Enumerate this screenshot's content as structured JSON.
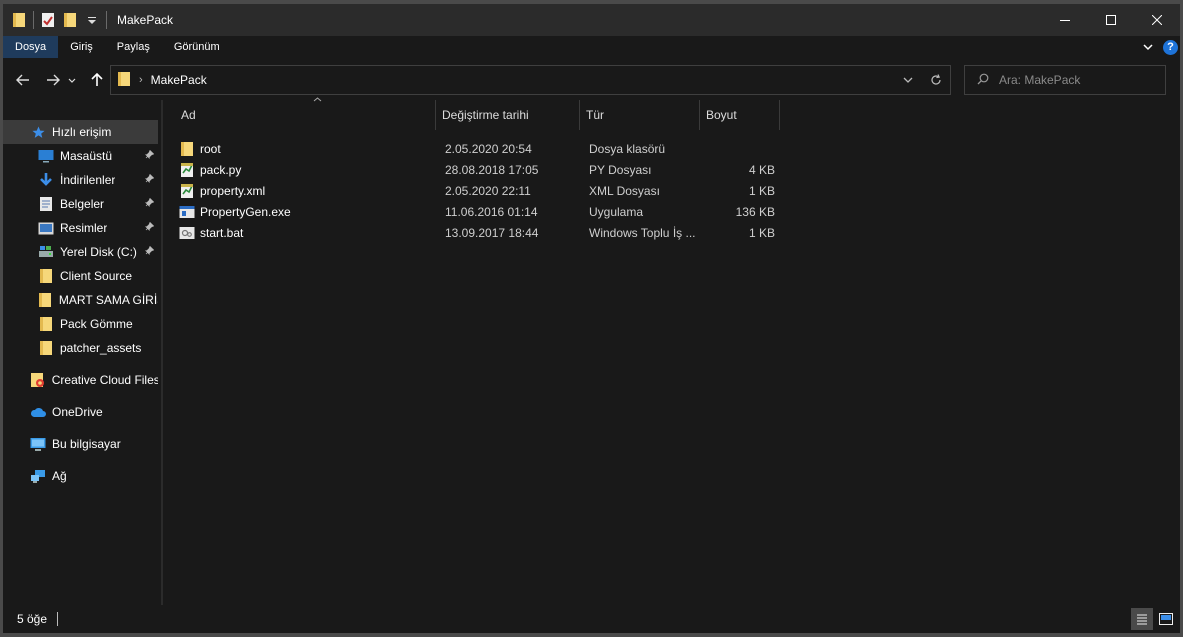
{
  "window": {
    "title": "MakePack"
  },
  "ribbon": {
    "tabs": [
      {
        "label": "Dosya",
        "active": true
      },
      {
        "label": "Giriş",
        "active": false
      },
      {
        "label": "Paylaş",
        "active": false
      },
      {
        "label": "Görünüm",
        "active": false
      }
    ],
    "help_label": "?"
  },
  "address": {
    "crumb": "MakePack"
  },
  "search": {
    "placeholder": "Ara: MakePack"
  },
  "nav": {
    "items": [
      {
        "label": "Hızlı erişim",
        "icon": "star-icon"
      },
      {
        "label": "Masaüstü",
        "icon": "desktop-icon",
        "pinned": true
      },
      {
        "label": "İndirilenler",
        "icon": "download-icon",
        "pinned": true
      },
      {
        "label": "Belgeler",
        "icon": "documents-icon",
        "pinned": true
      },
      {
        "label": "Resimler",
        "icon": "pictures-icon",
        "pinned": true
      },
      {
        "label": "Yerel Disk (C:)",
        "icon": "disk-icon",
        "pinned": true
      },
      {
        "label": "Client Source",
        "icon": "folder-icon"
      },
      {
        "label": "MART SAMA GİRİŞ",
        "icon": "folder-icon"
      },
      {
        "label": "Pack Gömme",
        "icon": "folder-icon"
      },
      {
        "label": "patcher_assets",
        "icon": "folder-icon"
      },
      {
        "label": "Creative Cloud Files",
        "icon": "creative-cloud-icon"
      },
      {
        "label": "OneDrive",
        "icon": "onedrive-icon"
      },
      {
        "label": "Bu bilgisayar",
        "icon": "computer-icon"
      },
      {
        "label": "Ağ",
        "icon": "network-icon"
      }
    ]
  },
  "columns": {
    "name": "Ad",
    "date": "Değiştirme tarihi",
    "type": "Tür",
    "size": "Boyut"
  },
  "files": [
    {
      "name": "root",
      "date": "2.05.2020 20:54",
      "type": "Dosya klasörü",
      "size": "",
      "icon": "folder-icon"
    },
    {
      "name": "pack.py",
      "date": "28.08.2018 17:05",
      "type": "PY Dosyası",
      "size": "4 KB",
      "icon": "python-file-icon"
    },
    {
      "name": "property.xml",
      "date": "2.05.2020 22:11",
      "type": "XML Dosyası",
      "size": "1 KB",
      "icon": "xml-file-icon"
    },
    {
      "name": "PropertyGen.exe",
      "date": "11.06.2016 01:14",
      "type": "Uygulama",
      "size": "136 KB",
      "icon": "exe-file-icon"
    },
    {
      "name": "start.bat",
      "date": "13.09.2017 18:44",
      "type": "Windows Toplu İş ...",
      "size": "1 KB",
      "icon": "bat-file-icon"
    }
  ],
  "status": {
    "count": "5 öğe"
  },
  "colors": {
    "folder": "#f6d77a",
    "accent": "#1e73d8",
    "selected_tab": "#1f3b5c"
  }
}
